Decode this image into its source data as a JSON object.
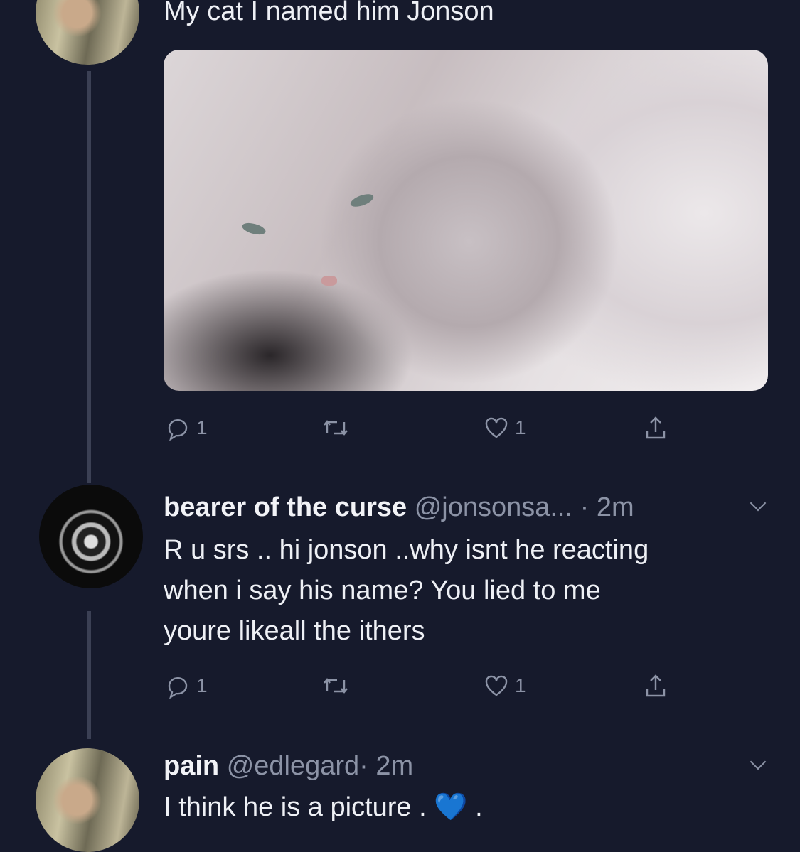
{
  "tweets": [
    {
      "text": "My cat I named him Jonson",
      "image_alt": "cat photo",
      "reply_count": "1",
      "like_count": "1"
    },
    {
      "name": "bearer of the curse",
      "handle": "@jonsonsa...",
      "time": "· 2m",
      "lines": [
        "R u srs .. hi jonson ..why isnt he reacting",
        "when i say his name? You lied to me",
        "youre likeall the ithers"
      ],
      "reply_count": "1",
      "like_count": "1"
    },
    {
      "name": "pain",
      "handle": "@edlegard",
      "time": "· 2m",
      "text": "I think he is a picture .",
      "emoji": "💙",
      "after": " ."
    }
  ]
}
